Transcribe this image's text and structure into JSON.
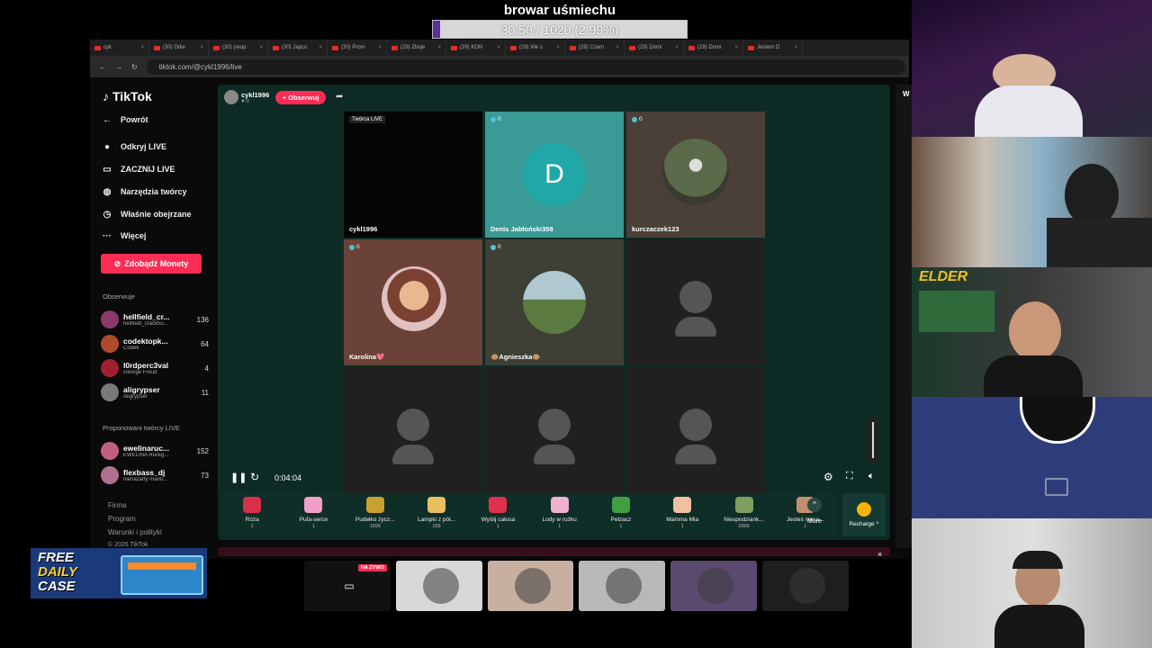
{
  "goal": {
    "title": "browar uśmiechu",
    "progress_text": "30.50 / 1020 (2.99%)",
    "progress_fraction": 0.0299
  },
  "browser": {
    "tabs": [
      "cyk",
      "(30) Odw",
      "(30) (reup",
      "(30) Japco",
      "(30) Prom",
      "(29) Zboje",
      "(29) KON",
      "(29) We s",
      "(29) Czem",
      "(29) Domi",
      "(29) Domi",
      "Jestem D"
    ],
    "url": "tiktok.com/@cykl1996/live"
  },
  "sidebar": {
    "logo": "TikTok",
    "nav": [
      {
        "label": "Powrót",
        "icon": "back-arrow-icon",
        "glyph": "←"
      },
      {
        "label": "Odkryj LIVE",
        "icon": "live-avatar-icon",
        "glyph": "●"
      },
      {
        "label": "ZACZNIJ LIVE",
        "icon": "camera-icon",
        "glyph": "▭"
      },
      {
        "label": "Narzędzia twórcy",
        "icon": "lightbulb-icon",
        "glyph": "◍"
      },
      {
        "label": "Właśnie obejrzane",
        "icon": "history-icon",
        "glyph": "◷"
      },
      {
        "label": "Więcej",
        "icon": "more-icon",
        "glyph": "···"
      }
    ],
    "coins_label": "Zdobądź Monety",
    "following_header": "Obserwuje",
    "following": [
      {
        "name": "hellfield_cr...",
        "sub": "hellfield_crackho...",
        "count": "136",
        "color": "#8a3a6a"
      },
      {
        "name": "codektopk...",
        "sub": "Codek",
        "count": "64",
        "color": "#b04a2a"
      },
      {
        "name": "l0rdperc3val",
        "sub": "George Freud",
        "count": "4",
        "color": "#a02030"
      },
      {
        "name": "aligrypser",
        "sub": "Aligrypser",
        "count": "11",
        "color": "#7a7a7a"
      }
    ],
    "suggested_header": "Proponowani twórcy LIVE",
    "suggested": [
      {
        "name": "ewelinaruc...",
        "sub": "EWELINA Ruckg...",
        "count": "152",
        "color": "#c06080"
      },
      {
        "name": "flexbass_dj",
        "sub": "nienażarty mariu...",
        "count": "73",
        "color": "#b07090"
      }
    ],
    "footer": [
      "Firma",
      "Program",
      "Warunki i polityki",
      "© 2026 TikTok"
    ]
  },
  "live": {
    "host_name": "cykl1996",
    "host_sub": "♥ 0",
    "follow_label": "+ Obserwuj",
    "grid": [
      {
        "label": "cykl1996",
        "badge": "Twórca LIVE",
        "type": "dark",
        "color": "#050505"
      },
      {
        "label": "Denis Jabłoński358",
        "badge": "0",
        "type": "letter",
        "letter": "D",
        "color": "#3a9a95"
      },
      {
        "label": "kurczaczek123",
        "badge": "0",
        "type": "photo",
        "color": "#4a4038"
      },
      {
        "label": "Karolina💖",
        "badge": "0",
        "type": "photo",
        "color": "#6a4238"
      },
      {
        "label": "🐵Agnieszka🐵",
        "badge": "0",
        "type": "photo",
        "color": "#3e4036"
      },
      {
        "label": "",
        "badge": "",
        "type": "empty",
        "color": "#202020"
      },
      {
        "label": "",
        "badge": "",
        "type": "empty",
        "color": "#202020"
      },
      {
        "label": "",
        "badge": "",
        "type": "empty",
        "color": "#202020"
      },
      {
        "label": "",
        "badge": "",
        "type": "empty",
        "color": "#202020"
      }
    ],
    "time": "0:04:04",
    "gifts": [
      {
        "name": "Róża",
        "price": "1",
        "color": "#d8304a"
      },
      {
        "name": "Pufa-serce",
        "price": "1",
        "color": "#f0a0c8"
      },
      {
        "name": "Pudełko życz...",
        "price": "1999",
        "color": "#c8a030"
      },
      {
        "name": "Lampki z pół...",
        "price": "299",
        "color": "#e8c060"
      },
      {
        "name": "Wyślij całusa",
        "price": "1",
        "color": "#e03050"
      },
      {
        "name": "Lody w rożku",
        "price": "1",
        "color": "#f0b0d0"
      },
      {
        "name": "Pełzacz",
        "price": "1",
        "color": "#40a040"
      },
      {
        "name": "Mamma Mia",
        "price": "1",
        "color": "#f0c0a0"
      },
      {
        "name": "Niespodziank...",
        "price": "2999",
        "color": "#80a060"
      },
      {
        "name": "Jesteś niesa...",
        "price": "1",
        "color": "#c09070"
      }
    ],
    "more_label": "More",
    "recharge_label": "Recharge ^",
    "close_x": "×"
  },
  "thumbnails": [
    {
      "badge": "NA ŻYWO",
      "color": "#111111"
    },
    {
      "badge": "",
      "color": "#d8d8d8"
    },
    {
      "badge": "",
      "color": "#c8b0a0"
    },
    {
      "badge": "",
      "color": "#b8b8b8"
    },
    {
      "badge": "",
      "color": "#5a4a70"
    },
    {
      "badge": "",
      "color": "#1e1e1e"
    }
  ],
  "promo": {
    "line1": "FREE",
    "line2": "DAILY",
    "line3": "CASE"
  },
  "cams": {
    "overlay_logo": "ELDER",
    "strip_letter": "W"
  }
}
